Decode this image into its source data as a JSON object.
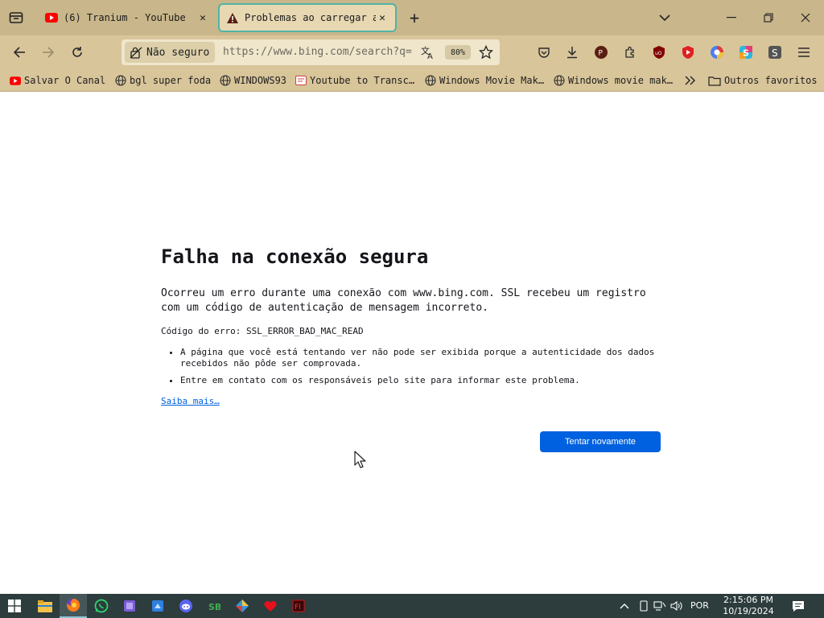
{
  "tabs": [
    {
      "title": "(6) Tranium - YouTube",
      "icon": "youtube-icon"
    },
    {
      "title": "Problemas ao carregar a",
      "icon": "warning-icon"
    }
  ],
  "window_controls": {
    "minimize": "minimize-icon",
    "maximize": "restore-icon",
    "close": "close-icon"
  },
  "urlbar": {
    "security_label": "Não seguro",
    "url": "https://www.bing.com/search?q=",
    "zoom": "80%"
  },
  "bookmarks": [
    {
      "label": "Salvar O Canal",
      "icon": "youtube-icon"
    },
    {
      "label": "bgl super foda",
      "icon": "globe-icon"
    },
    {
      "label": "WINDOWS93",
      "icon": "globe-icon"
    },
    {
      "label": "Youtube to Transc…",
      "icon": "page-icon"
    },
    {
      "label": "Windows Movie Mak…",
      "icon": "globe-icon"
    },
    {
      "label": "Windows movie mak…",
      "icon": "globe-icon"
    },
    {
      "label": "Outros favoritos",
      "icon": "folder-icon"
    }
  ],
  "error": {
    "title": "Falha na conexão segura",
    "description": "Ocorreu um erro durante uma conexão com www.bing.com. SSL recebeu um registro com um código de autenticação de mensagem incorreto.",
    "code_label": "Código do erro: SSL_ERROR_BAD_MAC_READ",
    "bullets": [
      "A página que você está tentando ver não pode ser exibida porque a autenticidade dos dados recebidos não pôde ser comprovada.",
      "Entre em contato com os responsáveis pelo site para informar este problema."
    ],
    "learn_more": "Saiba mais…",
    "retry_button": "Tentar novamente"
  },
  "taskbar": {
    "language": "POR",
    "time": "2:15:06 PM",
    "date": "10/19/2024"
  },
  "colors": {
    "tabstrip": "#c9b68a",
    "toolbar": "#d8c59a",
    "accent": "#0061e0",
    "taskbar": "#2d3c3c"
  }
}
